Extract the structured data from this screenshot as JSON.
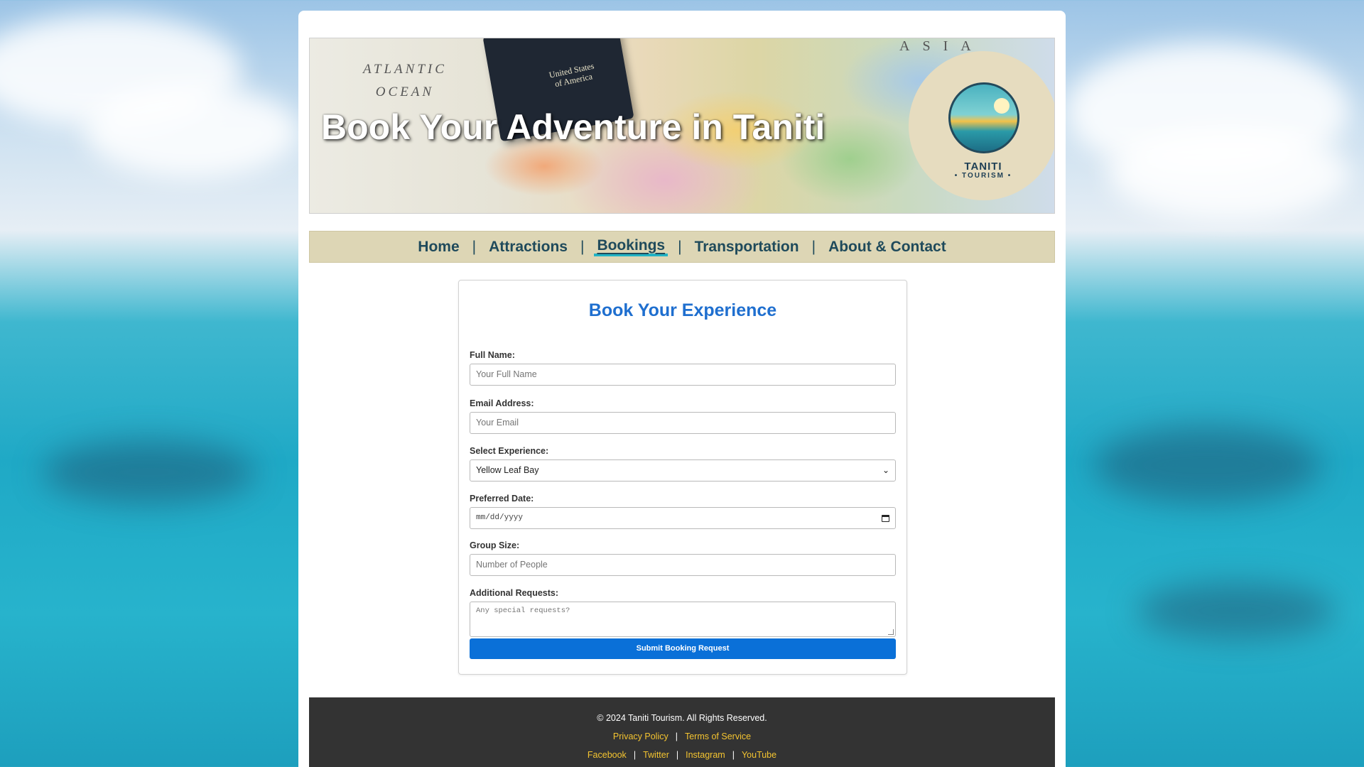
{
  "banner": {
    "title": "Book Your Adventure in Taniti",
    "map_labels": {
      "ocean_line1": "ATLANTIC",
      "ocean_line2": "OCEAN",
      "asia": "ASIA",
      "passport_line1": "United States",
      "passport_line2": "of America"
    },
    "logo": {
      "name": "TANITI",
      "sub": "• TOURISM •",
      "icon": "island-palm-sun-logo"
    }
  },
  "nav": {
    "items": [
      {
        "label": "Home"
      },
      {
        "label": "Attractions"
      },
      {
        "label": "Bookings",
        "active": true
      },
      {
        "label": "Transportation"
      },
      {
        "label": "About & Contact"
      }
    ],
    "separator": "|"
  },
  "form": {
    "heading": "Book Your Experience",
    "full_name": {
      "label": "Full Name:",
      "placeholder": "Your Full Name"
    },
    "email": {
      "label": "Email Address:",
      "placeholder": "Your Email"
    },
    "experience": {
      "label": "Select Experience:",
      "selected": "Yellow Leaf Bay"
    },
    "date": {
      "label": "Preferred Date:",
      "placeholder": "mm/dd/yyyy"
    },
    "group_size": {
      "label": "Group Size:",
      "placeholder": "Number of People"
    },
    "requests": {
      "label": "Additional Requests:",
      "placeholder": "Any special requests?"
    },
    "submit_label": "Submit Booking Request"
  },
  "footer": {
    "copyright": "© 2024 Taniti Tourism. All Rights Reserved.",
    "legal_links": [
      "Privacy Policy",
      "Terms of Service"
    ],
    "social_links": [
      "Facebook",
      "Twitter",
      "Instagram",
      "YouTube"
    ],
    "separator": "|"
  },
  "colors": {
    "accent": "#1f6fcf",
    "button": "#0a70d8",
    "nav_bg": "#ddd6b5",
    "nav_text": "#1f4a5b",
    "active_underline": "#22b3c4",
    "footer_bg": "#333333",
    "footer_link": "#f4c430"
  }
}
